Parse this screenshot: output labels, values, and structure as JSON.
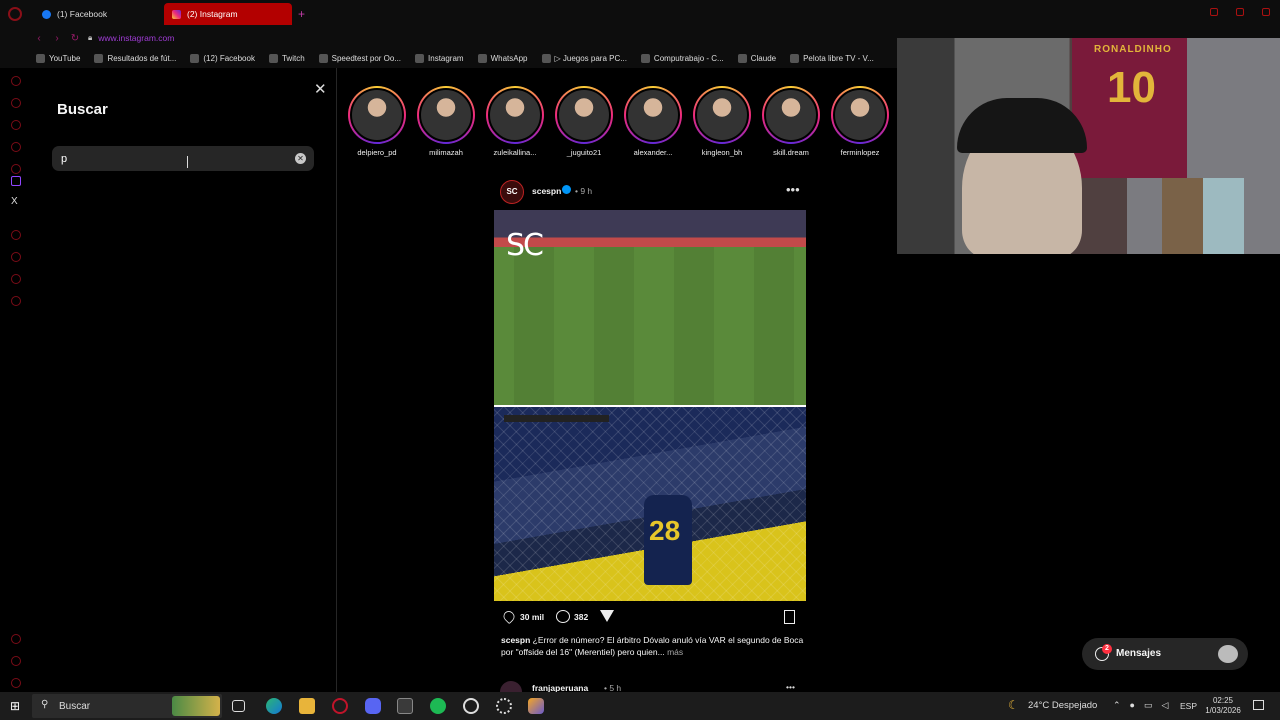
{
  "browser": {
    "tabs": [
      {
        "label": "(1) Facebook",
        "active": false
      },
      {
        "label": "(2) Instagram",
        "active": true
      }
    ],
    "url": "www.instagram.com",
    "bookmarks": [
      {
        "label": "YouTube",
        "icon": "youtube-icon"
      },
      {
        "label": "Resultados de fút...",
        "icon": "globe-icon"
      },
      {
        "label": "(12) Facebook",
        "icon": "facebook-icon"
      },
      {
        "label": "Twitch",
        "icon": "twitch-icon"
      },
      {
        "label": "Speedtest por Oo...",
        "icon": "speedtest-icon"
      },
      {
        "label": "Instagram",
        "icon": "instagram-icon"
      },
      {
        "label": "WhatsApp",
        "icon": "whatsapp-icon"
      },
      {
        "label": "▷ Juegos para PC...",
        "icon": "page-icon"
      },
      {
        "label": "Computrabajo - C...",
        "icon": "computrabajo-icon"
      },
      {
        "label": "Claude",
        "icon": "claude-icon"
      },
      {
        "label": "Pelota libre TV - V...",
        "icon": "tv-icon"
      }
    ],
    "accent": "#b30000"
  },
  "search_panel": {
    "title": "Buscar",
    "input_value": "p",
    "close_icon": "close-icon",
    "clear_icon": "clear-icon"
  },
  "stories": [
    {
      "username": "delpiero_pd"
    },
    {
      "username": "milimazah"
    },
    {
      "username": "zuleikallina..."
    },
    {
      "username": "_juguito21"
    },
    {
      "username": "alexander..."
    },
    {
      "username": "kingleon_bh"
    },
    {
      "username": "skill.dream"
    },
    {
      "username": "ferminlopez"
    }
  ],
  "post": {
    "avatar_text": "SC",
    "username": "scespn",
    "time": "• 9 h",
    "media_overlay": "SC",
    "jersey_number": "28",
    "likes": "30 mil",
    "comments": "382",
    "caption_user": "scespn",
    "caption_text": " ¿Error de número? El árbitro Dóvalo anuló vía VAR el segundo de Boca por \"offside del 16\" (Merentiel) pero quien...",
    "caption_more": " más"
  },
  "next_post": {
    "username": "franjaperuana",
    "time": "• 5 h"
  },
  "webcam": {
    "shirt_name": "RONALDINHO",
    "shirt_number": "10"
  },
  "messages": {
    "label": "Mensajes",
    "badge": "2"
  },
  "taskbar": {
    "search_label": "Buscar",
    "weather": "24°C  Despejado",
    "language": "ESP",
    "time": "02:25",
    "date": "1/03/2026"
  }
}
